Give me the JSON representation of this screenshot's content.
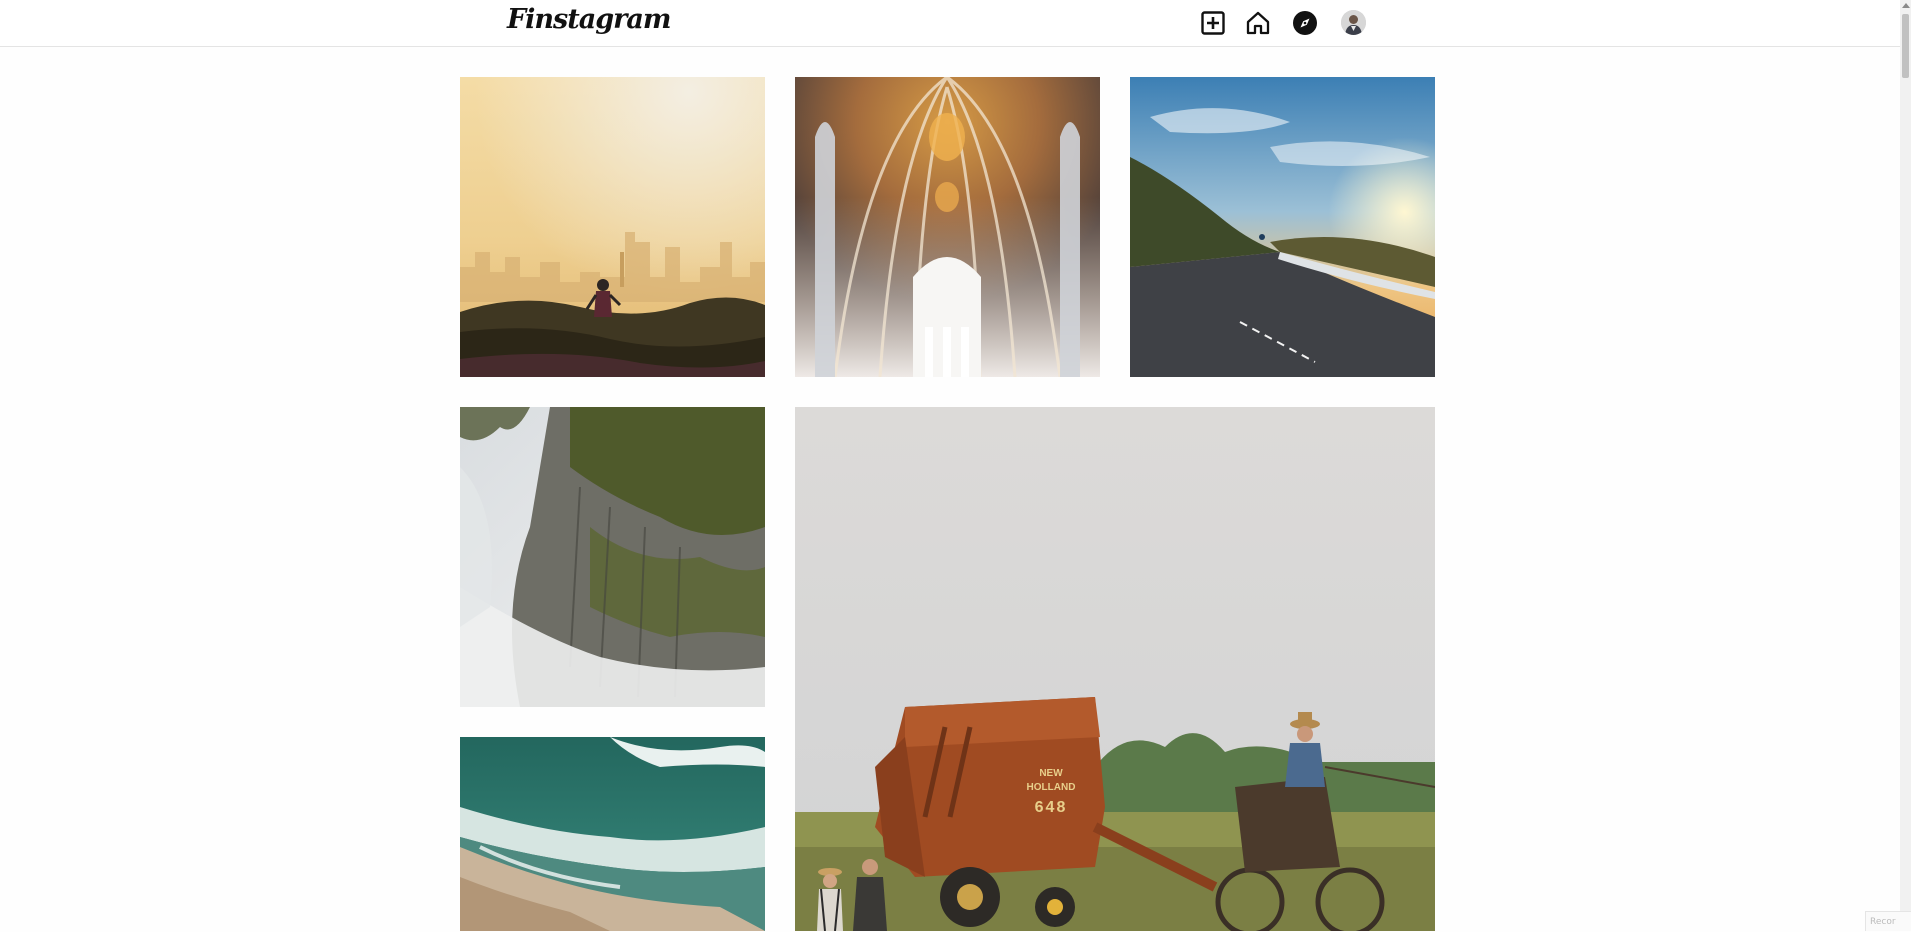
{
  "app": {
    "logo_text": "Finstagram"
  },
  "nav": {
    "icons": [
      "add-post-icon",
      "home-icon",
      "explore-compass-icon"
    ],
    "profile_avatar": "profile-avatar"
  },
  "feed": {
    "posts": [
      {
        "subject": "runner-in-misty-field"
      },
      {
        "subject": "cathedral-vaulted-ceiling"
      },
      {
        "subject": "cyclist-on-mountain-road-at-sunset"
      },
      {
        "subject": "misty-cliff-face"
      },
      {
        "subject": "farmer-with-new-holland-baler"
      },
      {
        "subject": "ocean-waves-on-beach"
      }
    ]
  },
  "baler_text": {
    "brand": "NEW HOLLAND",
    "model": "648"
  },
  "overlay": {
    "badge_text": "Recor"
  },
  "colors": {
    "accent": "#111111",
    "background": "#fefefe",
    "divider": "#e4e4e4"
  }
}
